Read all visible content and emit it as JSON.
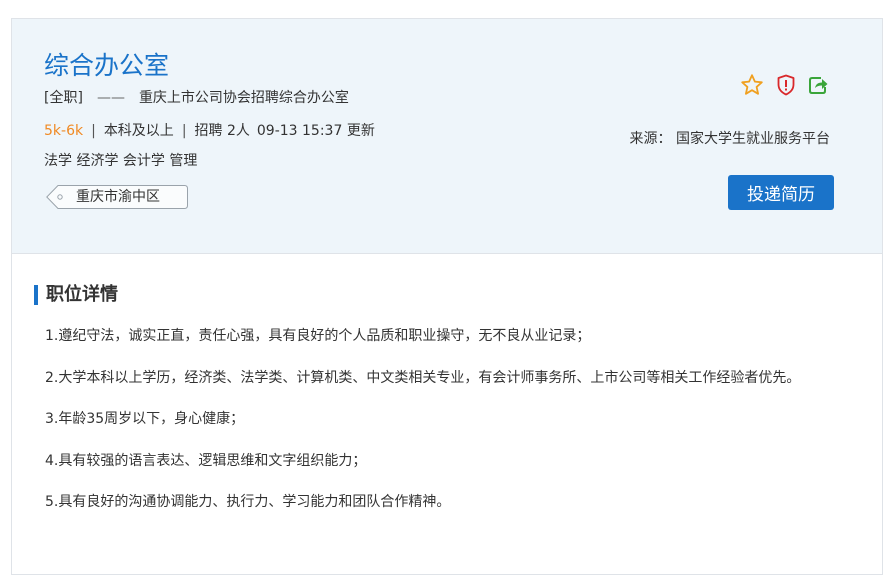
{
  "job": {
    "title": "综合办公室",
    "type": "[全职]",
    "dash": "——",
    "company": "重庆上市公司协会招聘综合办公室",
    "salary": "5k-6k",
    "sep": "|",
    "education": "本科及以上",
    "headcount": "招聘 2人",
    "updated": "09-13 15:37 更新",
    "majors": "法学 经济学 会计学 管理",
    "location": "重庆市渝中区"
  },
  "actions": {
    "favorite_icon": "star-icon",
    "report_icon": "shield-alert-icon",
    "share_icon": "share-icon",
    "apply_label": "投递简历"
  },
  "source": {
    "text": "来源： 国家大学生就业服务平台"
  },
  "details": {
    "heading": "职位详情",
    "items": [
      "1.遵纪守法，诚实正直，责任心强，具有良好的个人品质和职业操守，无不良从业记录；",
      "2.大学本科以上学历，经济类、法学类、计算机类、中文类相关专业，有会计师事务所、上市公司等相关工作经验者优先。",
      "3.年龄35周岁以下，身心健康；",
      "4.具有较强的语言表达、逻辑思维和文字组织能力；",
      "5.具有良好的沟通协调能力、执行力、学习能力和团队合作精神。"
    ]
  },
  "colors": {
    "accent": "#1a73c9",
    "salary": "#f08a24",
    "star": "#f0a020",
    "report": "#d9282b",
    "share": "#3aa53a",
    "header_bg": "#eef5fa"
  }
}
